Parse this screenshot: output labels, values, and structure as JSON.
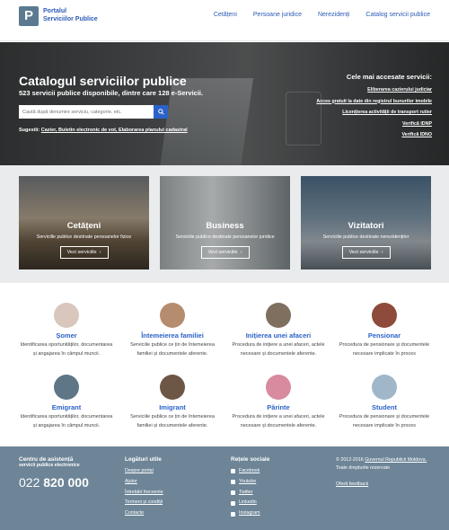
{
  "header": {
    "logo_letter": "P",
    "logo_line1": "Portalul",
    "logo_line2": "Serviciilor Publice",
    "nav": [
      "Cetățeni",
      "Persoane juridice",
      "Nerezidenți",
      "Catalog servicii publice"
    ]
  },
  "hero": {
    "title": "Catalogul serviciilor publice",
    "subtitle": "523 servicii publice disponibile, dintre care 128 e-Servicii.",
    "search_placeholder": "Caută după denumire serviciu, categorie, etc.",
    "suggestions_label": "Sugestii:",
    "suggestions": "Cazier, Buletin electronic de vot, Elaborarea planului cadastral",
    "popular_title": "Cele mai accesate servicii:",
    "popular": [
      "Eliberarea cazierului judiciar",
      "Acces gratuit la date din registrul bunurilor imobile",
      "Licențierea activității de transport rutier",
      "Verifică IDNP",
      "Verifică IDNO"
    ]
  },
  "cards": [
    {
      "title": "Cetățeni",
      "sub": "Servicille publice destinate persoanelor fizice",
      "btn": "Vezi serviciile"
    },
    {
      "title": "Business",
      "sub": "Serviciile publice destinate persoanelor juridice",
      "btn": "Vezi serviciile"
    },
    {
      "title": "Vizitatori",
      "sub": "Serviciile publice destinate nerezidenților",
      "btn": "Vezi serviciile"
    }
  ],
  "categories": [
    {
      "name": "Șomer",
      "desc1": "Identificarea oportunităților, documentarea",
      "desc2": "și angajarea în câmpul muncii.",
      "color": "#d9c7bd"
    },
    {
      "name": "Întemeierea familiei",
      "desc1": "Serviciile publice ce țin de întemeierea",
      "desc2": "familiei și documentele aferente.",
      "color": "#b58d6e"
    },
    {
      "name": "Inițierea unei afaceri",
      "desc1": "Procedura de inițiere a unei afaceri, actele",
      "desc2": "necesare și documentele aferente.",
      "color": "#7e6f5f"
    },
    {
      "name": "Pensionar",
      "desc1": "Procedura de pensionare și documentele",
      "desc2": "necesare implicate în proces",
      "color": "#8e4a3a"
    },
    {
      "name": "Emigrant",
      "desc1": "Identificarea oportunităților, documentarea",
      "desc2": "și angajarea în câmpul muncii.",
      "color": "#5f7686"
    },
    {
      "name": "Imigrant",
      "desc1": "Serviciile publice ce țin de întemeierea",
      "desc2": "familiei și documentele aferente.",
      "color": "#6d5646"
    },
    {
      "name": "Părinte",
      "desc1": "Procedura de inițiere a unei afaceri, actele",
      "desc2": "necesare și documentele aferente.",
      "color": "#d88a9e"
    },
    {
      "name": "Student",
      "desc1": "Procedura de pensionare și documentele",
      "desc2": "necesare implicate în proces",
      "color": "#9fb7c9"
    }
  ],
  "footer": {
    "assist_title": "Centru de asistență",
    "assist_sub": "servicii publice electronice",
    "phone_prefix": "022",
    "phone_number": "820 000",
    "links_title": "Legături utile",
    "links": [
      "Despre portal",
      "Ajutor",
      "Întrebări frecvente",
      "Termeni și condiții",
      "Contacte"
    ],
    "social_title": "Rețele sociale",
    "social": [
      "Facebook",
      "Youtube",
      "Twitter",
      "Linkedin",
      "Instagram"
    ],
    "copyright_prefix": "© 2012-2016 ",
    "copyright_link": "Guvernul Republicii Moldova.",
    "copyright_rest": "Toate drepturile rezervate",
    "feedback": "Oferă feedback"
  }
}
